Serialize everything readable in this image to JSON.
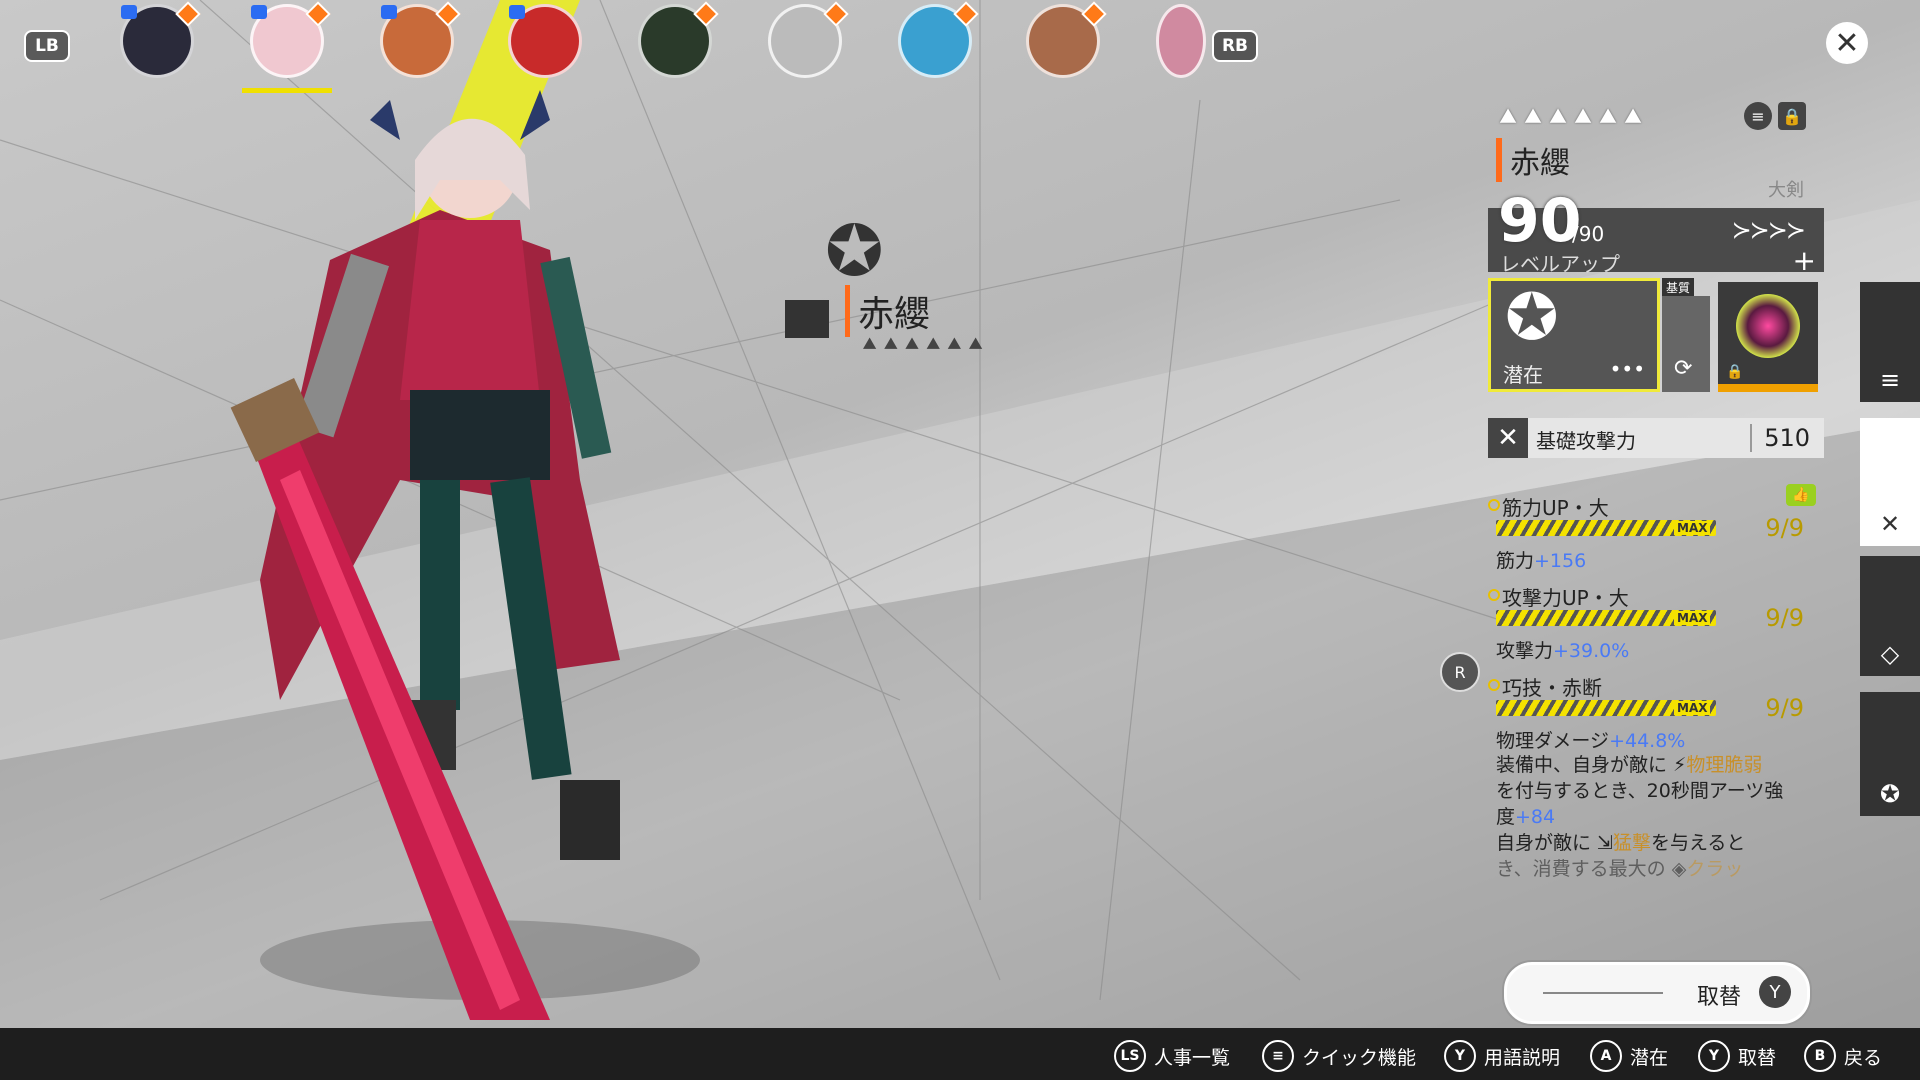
{
  "topbar": {
    "lb_label": "LB",
    "rb_label": "RB",
    "close_icon": "close-icon",
    "portraits": [
      {
        "name": "character-portrait-1",
        "color": "#2a2a3a"
      },
      {
        "name": "character-portrait-2-selected",
        "color": "#f0c8d0"
      },
      {
        "name": "character-portrait-3",
        "color": "#c86a3a"
      },
      {
        "name": "character-portrait-4",
        "color": "#c82a2a"
      },
      {
        "name": "character-portrait-5",
        "color": "#2a3a2a"
      },
      {
        "name": "character-portrait-6",
        "color": "#bbbbbb"
      },
      {
        "name": "character-portrait-7",
        "color": "#3aa0d0"
      },
      {
        "name": "character-portrait-8",
        "color": "#a86a4a"
      },
      {
        "name": "character-portrait-9",
        "color": "#d08aa0"
      }
    ]
  },
  "float": {
    "name": "赤纓",
    "stars": "⯅⯅⯅⯅⯅⯅"
  },
  "panel": {
    "rank_stars": "⯅⯅⯅⯅⯅⯅",
    "char_name": "赤纓",
    "weapon_type": "大剣",
    "level": "90",
    "level_max": "/90",
    "level_up_label": "レベルアップ",
    "potential_label": "潜在",
    "potential_more": "•••",
    "base_tag": "基質",
    "base_attack_label": "基礎攻撃力",
    "base_attack_value": "510",
    "skills": [
      {
        "title": "筋力UP・大",
        "count": "9/9",
        "max": "MAX",
        "stat_label": "筋力",
        "stat_plus": "+156"
      },
      {
        "title": "攻撃力UP・大",
        "count": "9/9",
        "max": "MAX",
        "stat_label": "攻撃力",
        "stat_plus": "+39.0%"
      },
      {
        "title": "巧技・赤断",
        "count": "9/9",
        "max": "MAX",
        "stat_label": "物理ダメージ",
        "stat_plus": "+44.8%"
      }
    ],
    "desc": {
      "line1a": "装備中、自身が敵に ",
      "line1_hl": "物理脆弱",
      "line2": "を付与するとき、20秒間アーツ強",
      "line3a": "度",
      "line3_plus": "+84",
      "line4a": "自身が敵に ",
      "line4_hl": "猛撃",
      "line4b": "を与えると",
      "line5a": "き、消費する最大の ",
      "line5_hl": "クラッ"
    }
  },
  "swap_button": {
    "label": "取替",
    "key": "Y"
  },
  "r_stick": "R",
  "hints": [
    {
      "key": "LS",
      "label": "人事一覧"
    },
    {
      "key": "≡",
      "label": "クイック機能"
    },
    {
      "key": "Y",
      "label": "用語説明"
    },
    {
      "key": "A",
      "label": "潜在"
    },
    {
      "key": "Y",
      "label": "取替"
    },
    {
      "key": "B",
      "label": "戻る"
    }
  ],
  "colors": {
    "accent": "#ff6a1a",
    "highlight": "#f0e000",
    "blue": "#4a7af5"
  }
}
